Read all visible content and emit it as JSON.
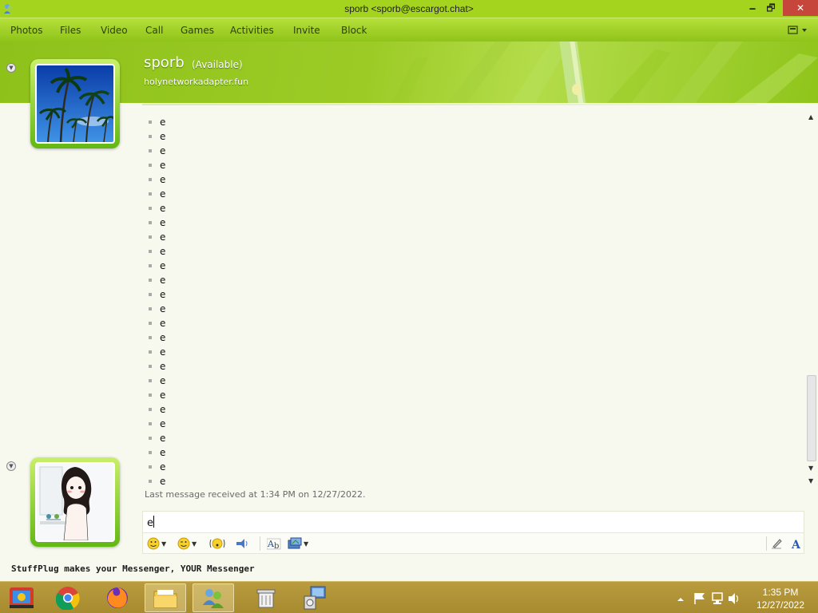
{
  "window": {
    "title": "sporb <sporb@escargot.chat>",
    "minimize_glyph": "🗕",
    "maximize_glyph": "🗗",
    "close_glyph": "✕"
  },
  "menu": {
    "items": [
      "Photos",
      "Files",
      "Video",
      "Call",
      "Games",
      "Activities",
      "Invite",
      "Block"
    ],
    "options_icon": "show-menu-icon"
  },
  "contact": {
    "name": "sporb",
    "status": "(Available)",
    "personal_message": "holynetworkadapter.fun",
    "display_picture": "palm-trees"
  },
  "conversation": {
    "messages": [
      "e",
      "e",
      "e",
      "e",
      "e",
      "e",
      "e",
      "e",
      "e",
      "e",
      "e",
      "e",
      "e",
      "e",
      "e",
      "e",
      "e",
      "e",
      "e",
      "e",
      "e",
      "e",
      "e",
      "e",
      "e",
      "e"
    ],
    "last_message_info": "Last message received at 1:34 PM on 12/27/2022."
  },
  "input": {
    "value": "e"
  },
  "toolbar": {
    "tools": [
      "emoticon-icon",
      "wink-icon",
      "voice-clip-icon",
      "nudge-icon",
      "font-icon",
      "background-icon",
      "handwriting-icon",
      "text-format-icon"
    ]
  },
  "footer": {
    "stuffplug_text": "StuffPlug makes your Messenger, YOUR Messenger"
  },
  "taskbar": {
    "apps": [
      "screen-recorder",
      "chrome",
      "firefox",
      "file-explorer",
      "messenger",
      "trash",
      "network-setup"
    ],
    "time": "1:35 PM",
    "date": "12/27/2022"
  },
  "colors": {
    "accent": "#8fc41a",
    "title_bar": "#a5d41f",
    "close_button": "#c7463c",
    "taskbar": "#a88a2f"
  }
}
